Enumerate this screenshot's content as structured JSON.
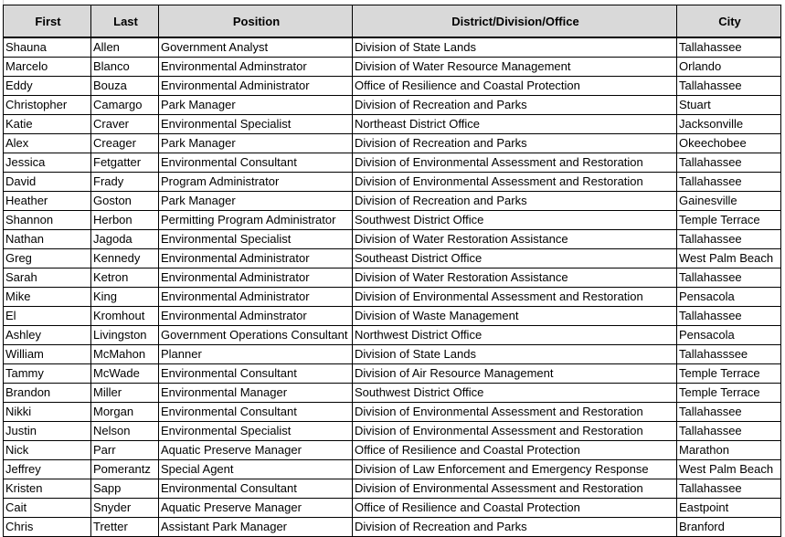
{
  "sheet": {
    "headers": [
      "First",
      "Last",
      "Position",
      "District/Division/Office",
      "City"
    ],
    "rows": [
      [
        "Shauna",
        "Allen",
        "Government Analyst",
        "Division of State Lands",
        "Tallahassee"
      ],
      [
        "Marcelo",
        "Blanco",
        "Environmental Adminstrator",
        "Division of Water Resource Management",
        "Orlando"
      ],
      [
        "Eddy",
        "Bouza",
        "Environmental Administrator",
        "Office of Resilience and Coastal Protection",
        "Tallahassee"
      ],
      [
        "Christopher",
        "Camargo",
        "Park Manager",
        "Division of Recreation and Parks",
        "Stuart"
      ],
      [
        "Katie",
        "Craver",
        "Environmental Specialist",
        "Northeast District Office",
        "Jacksonville"
      ],
      [
        "Alex",
        "Creager",
        "Park Manager",
        "Division of Recreation and Parks",
        "Okeechobee"
      ],
      [
        "Jessica",
        "Fetgatter",
        "Environmental Consultant",
        "Division of Environmental Assessment and Restoration",
        "Tallahassee"
      ],
      [
        "David",
        "Frady",
        "Program Administrator",
        "Division of Environmental Assessment and Restoration",
        "Tallahassee"
      ],
      [
        "Heather",
        "Goston",
        "Park Manager",
        "Division of Recreation and Parks",
        "Gainesville"
      ],
      [
        "Shannon",
        "Herbon",
        "Permitting Program Administrator",
        "Southwest District Office",
        "Temple Terrace"
      ],
      [
        "Nathan",
        "Jagoda",
        "Environmental Specialist",
        "Division of Water Restoration Assistance",
        "Tallahassee"
      ],
      [
        "Greg",
        "Kennedy",
        "Environmental Administrator",
        "Southeast District Office",
        "West Palm Beach"
      ],
      [
        "Sarah",
        "Ketron",
        "Environmental Administrator",
        "Division of Water Restoration Assistance",
        "Tallahassee"
      ],
      [
        "Mike",
        "King",
        "Environmental Administrator",
        "Division of Environmental Assessment and Restoration",
        "Pensacola"
      ],
      [
        "El",
        "Kromhout",
        "Environmental Adminstrator",
        "Division of Waste Management",
        "Tallahassee"
      ],
      [
        "Ashley",
        "Livingston",
        "Government Operations Consultant",
        "Northwest District Office",
        "Pensacola"
      ],
      [
        "William",
        "McMahon",
        "Planner",
        "Division of State Lands",
        "Tallahasssee"
      ],
      [
        "Tammy",
        "McWade",
        "Environmental Consultant",
        "Division of Air Resource Management",
        "Temple Terrace"
      ],
      [
        "Brandon",
        "Miller",
        "Environmental Manager",
        "Southwest District Office",
        "Temple Terrace"
      ],
      [
        "Nikki",
        "Morgan",
        "Environmental Consultant",
        "Division of Environmental Assessment and Restoration",
        "Tallahassee"
      ],
      [
        "Justin",
        "Nelson",
        "Environmental Specialist",
        "Division of Environmental Assessment and Restoration",
        "Tallahassee"
      ],
      [
        "Nick",
        "Parr",
        "Aquatic Preserve Manager",
        "Office of Resilience and Coastal Protection",
        "Marathon"
      ],
      [
        "Jeffrey",
        "Pomerantz",
        "Special Agent",
        "Division of Law Enforcement and Emergency Response",
        "West Palm Beach"
      ],
      [
        "Kristen",
        "Sapp",
        "Environmental Consultant",
        "Division of Environmental Assessment and Restoration",
        "Tallahassee"
      ],
      [
        "Cait",
        "Snyder",
        "Aquatic Preserve Manager",
        "Office of Resilience and Coastal Protection",
        "Eastpoint"
      ],
      [
        "Chris",
        "Tretter",
        "Assistant Park Manager",
        "Division of Recreation and Parks",
        "Branford"
      ]
    ]
  }
}
